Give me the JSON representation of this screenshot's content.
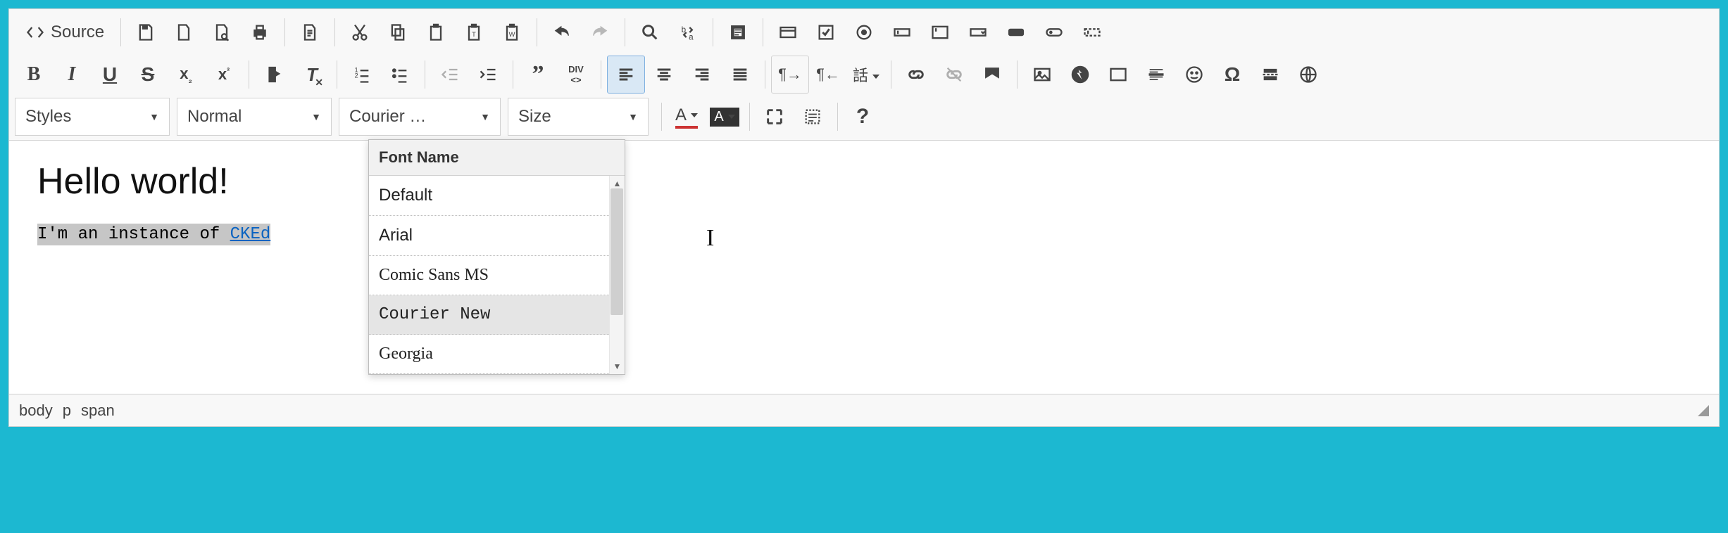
{
  "toolbar": {
    "source_label": "Source",
    "styles_label": "Styles",
    "format_label": "Normal",
    "font_label": "Courier …",
    "size_label": "Size"
  },
  "font_panel": {
    "title": "Font Name",
    "items": [
      {
        "label": "Default",
        "css": "font-family: Arial, sans-serif",
        "selected": false
      },
      {
        "label": "Arial",
        "css": "font-family: Arial, sans-serif",
        "selected": false
      },
      {
        "label": "Comic Sans MS",
        "css": "font-family: 'Comic Sans MS', cursive",
        "selected": false
      },
      {
        "label": "Courier New",
        "css": "font-family: 'Courier New', monospace",
        "selected": true
      },
      {
        "label": "Georgia",
        "css": "font-family: Georgia, serif",
        "selected": false
      }
    ]
  },
  "document": {
    "heading": "Hello world!",
    "selected_text_prefix": "I'm an instance of ",
    "selected_link_text": "CKEd"
  },
  "status": {
    "path": [
      "body",
      "p",
      "span"
    ]
  }
}
